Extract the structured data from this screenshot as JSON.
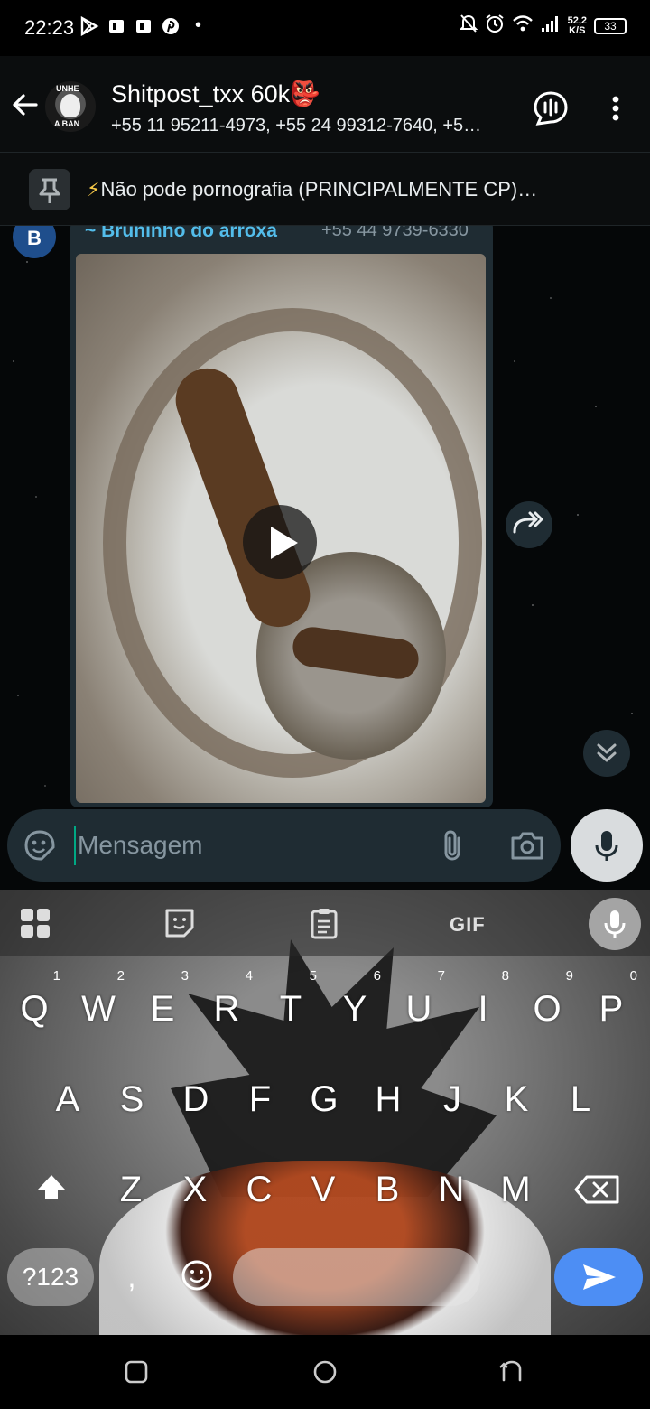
{
  "status_bar": {
    "time": "22:23",
    "net_speed_top": "52,2",
    "net_speed_bottom": "K/S",
    "battery": "33"
  },
  "header": {
    "group_name": "Shitpost_txx 60k👺",
    "members": "+55 11 95211-4973, +55 24 99312-7640, +5…",
    "avatar_lines": [
      "UNHE",
      "A BAN"
    ]
  },
  "pinned": {
    "bolt": "⚡",
    "text": "Não pode pornografia (PRINCIPALMENTE CP)…"
  },
  "message": {
    "avatar_letter": "B",
    "sender_name": "~ Bruninho do arroxa",
    "sender_phone": "+55 44 9739-6330"
  },
  "composer": {
    "placeholder": "Mensagem"
  },
  "keyboard": {
    "gif_label": "GIF",
    "row1": [
      {
        "key": "Q",
        "hint": "1"
      },
      {
        "key": "W",
        "hint": "2"
      },
      {
        "key": "E",
        "hint": "3"
      },
      {
        "key": "R",
        "hint": "4"
      },
      {
        "key": "T",
        "hint": "5"
      },
      {
        "key": "Y",
        "hint": "6"
      },
      {
        "key": "U",
        "hint": "7"
      },
      {
        "key": "I",
        "hint": "8"
      },
      {
        "key": "O",
        "hint": "9"
      },
      {
        "key": "P",
        "hint": "0"
      }
    ],
    "row2": [
      "A",
      "S",
      "D",
      "F",
      "G",
      "H",
      "J",
      "K",
      "L"
    ],
    "row3": [
      "Z",
      "X",
      "C",
      "V",
      "B",
      "N",
      "M"
    ],
    "symbols_label": "?123",
    "comma_label": ","
  },
  "colors": {
    "accent": "#00a884",
    "bubble": "#1f2c33",
    "sender_name": "#53bdeb",
    "send_key": "#4d8ef4"
  }
}
